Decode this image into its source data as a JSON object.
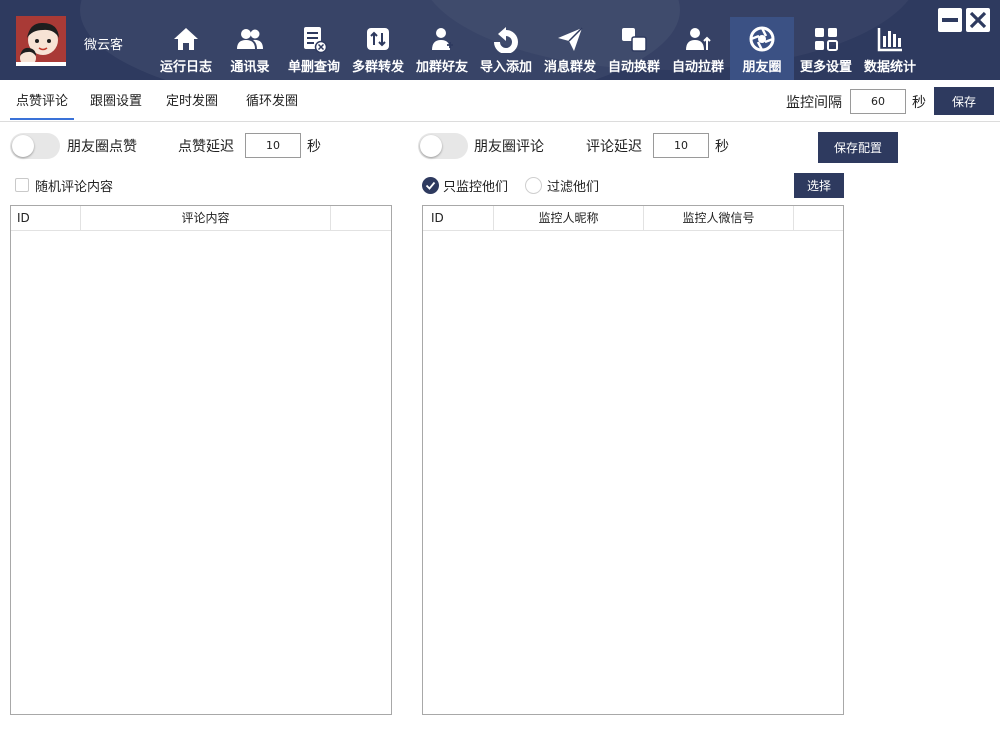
{
  "app": {
    "user_name": "微云客"
  },
  "nav": {
    "items": [
      {
        "label": "运行日志",
        "icon": "home-icon"
      },
      {
        "label": "通讯录",
        "icon": "contacts-icon"
      },
      {
        "label": "单删查询",
        "icon": "delete-check-icon"
      },
      {
        "label": "多群转发",
        "icon": "forward-icon"
      },
      {
        "label": "加群好友",
        "icon": "add-friend-icon"
      },
      {
        "label": "导入添加",
        "icon": "import-icon"
      },
      {
        "label": "消息群发",
        "icon": "send-icon"
      },
      {
        "label": "自动换群",
        "icon": "switch-group-icon"
      },
      {
        "label": "自动拉群",
        "icon": "pull-group-icon"
      },
      {
        "label": "朋友圈",
        "icon": "moments-icon"
      },
      {
        "label": "更多设置",
        "icon": "grid-icon"
      },
      {
        "label": "数据统计",
        "icon": "chart-icon"
      }
    ],
    "active": "朋友圈"
  },
  "tabs": {
    "items": [
      "点赞评论",
      "跟圈设置",
      "定时发圈",
      "循环发圈"
    ],
    "active": "点赞评论"
  },
  "monitor": {
    "label": "监控间隔",
    "value": "60",
    "unit": "秒",
    "save_label": "保存"
  },
  "like": {
    "toggle_label": "朋友圈点赞",
    "toggle_on": false,
    "delay_label": "点赞延迟",
    "delay_value": "10",
    "delay_unit": "秒",
    "random_comment_label": "随机评论内容",
    "random_comment_checked": false,
    "table": {
      "columns": [
        "ID",
        "评论内容"
      ],
      "rows": []
    }
  },
  "comment": {
    "toggle_label": "朋友圈评论",
    "toggle_on": false,
    "delay_label": "评论延迟",
    "delay_value": "10",
    "delay_unit": "秒",
    "save_config_label": "保存配置",
    "radio_only_label": "只监控他们",
    "radio_filter_label": "过滤他们",
    "radio_selected": "只监控他们",
    "select_label": "选择",
    "table": {
      "columns": [
        "ID",
        "监控人昵称",
        "监控人微信号"
      ],
      "rows": []
    }
  },
  "colors": {
    "header_bg": "#2e3a5f",
    "nav_active_bg": "#3b5184",
    "button_bg": "#2e3a5f",
    "tab_underline": "#3a72d8"
  }
}
